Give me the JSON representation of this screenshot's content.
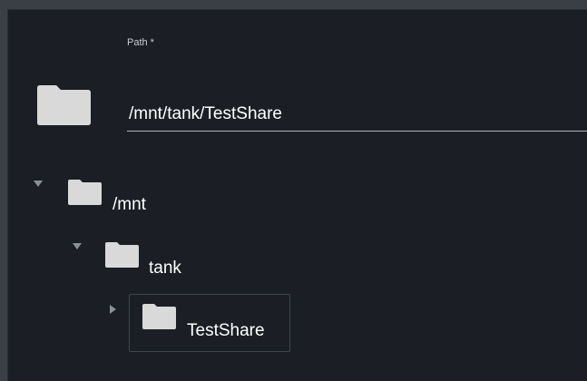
{
  "field": {
    "label": "Path *",
    "value": "/mnt/tank/TestShare",
    "icon": "folder-icon"
  },
  "tree": {
    "nodes": [
      {
        "label": "/mnt",
        "expanded": true,
        "icon": "folder-icon"
      },
      {
        "label": "tank",
        "expanded": true,
        "icon": "folder-icon"
      },
      {
        "label": "TestShare",
        "expanded": false,
        "selected": true,
        "icon": "folder-icon"
      }
    ]
  },
  "colors": {
    "panel_bg": "#1b1f25",
    "folder": "#d9d9d9",
    "text": "#ffffff",
    "arrow": "#8b9097"
  }
}
